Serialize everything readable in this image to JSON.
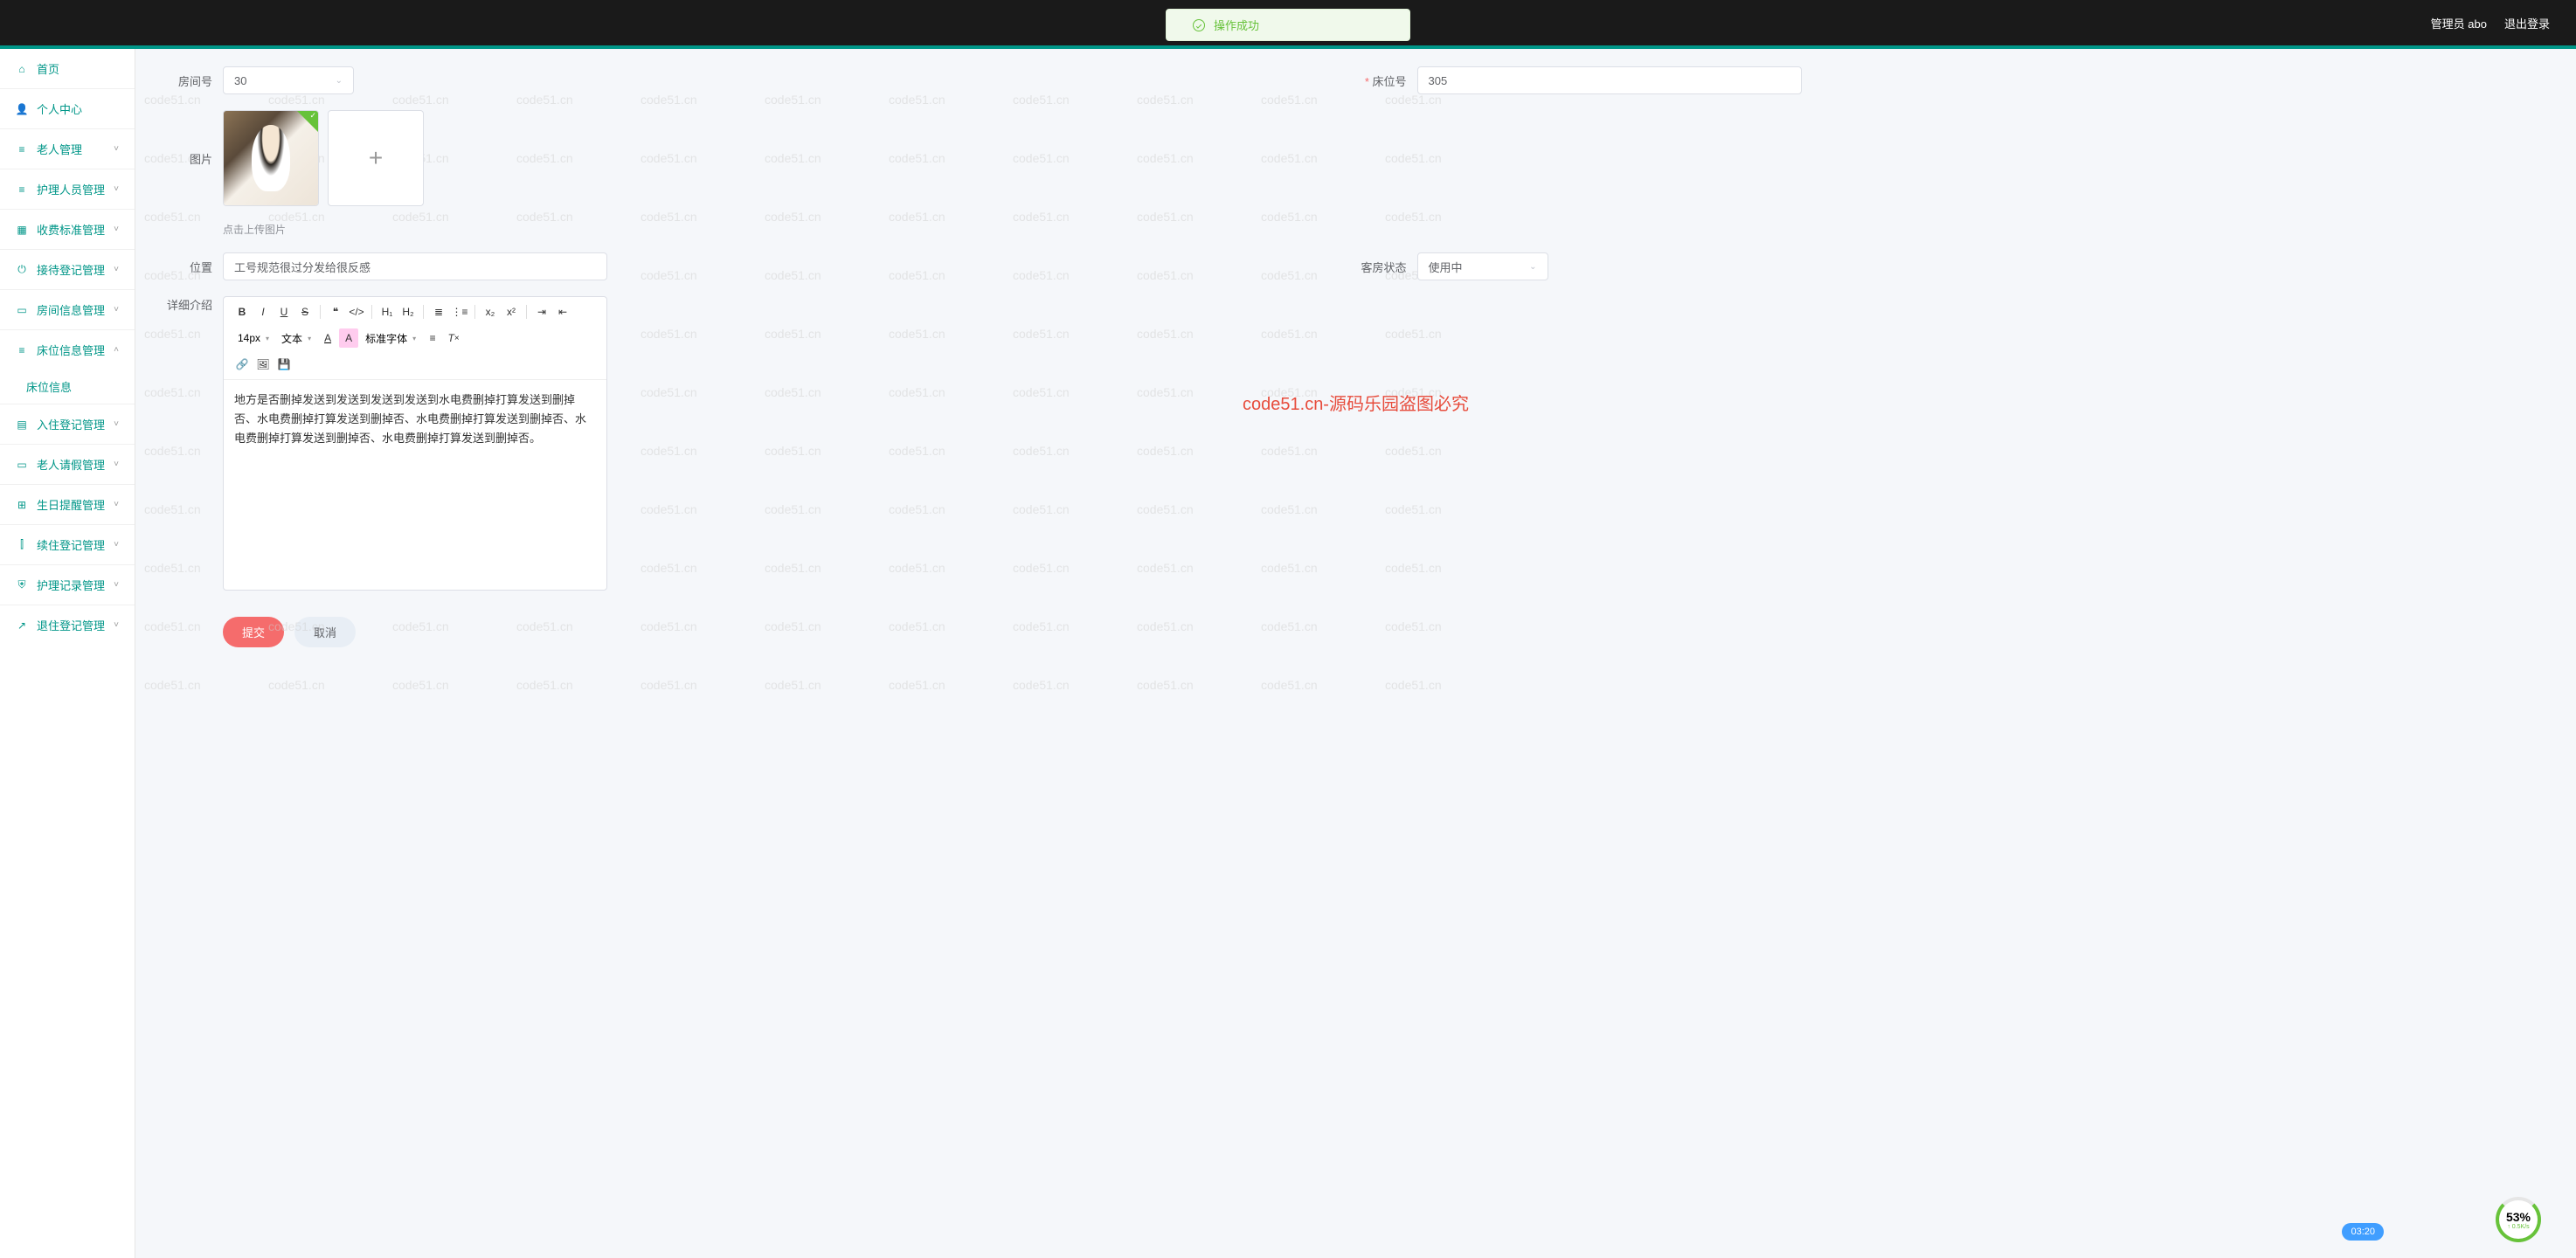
{
  "header": {
    "admin": "管理员 abo",
    "logout": "退出登录"
  },
  "toast": {
    "msg": "操作成功"
  },
  "sidebar": {
    "items": [
      {
        "label": "首页",
        "icon": "home-icon",
        "glyph": "⌂",
        "teal": true,
        "expand": false
      },
      {
        "label": "个人中心",
        "icon": "user-icon",
        "glyph": "👤",
        "teal": true,
        "expand": false
      },
      {
        "label": "老人管理",
        "icon": "list-icon",
        "glyph": "≡",
        "teal": true,
        "expand": true,
        "open": false
      },
      {
        "label": "护理人员管理",
        "icon": "list-icon",
        "glyph": "≡",
        "teal": true,
        "expand": true,
        "open": false
      },
      {
        "label": "收费标准管理",
        "icon": "money-icon",
        "glyph": "▦",
        "teal": true,
        "expand": true,
        "open": false
      },
      {
        "label": "接待登记管理",
        "icon": "power-icon",
        "glyph": "⏻",
        "teal": true,
        "expand": true,
        "open": false
      },
      {
        "label": "房间信息管理",
        "icon": "room-icon",
        "glyph": "▭",
        "teal": true,
        "expand": true,
        "open": false
      },
      {
        "label": "床位信息管理",
        "icon": "list-icon",
        "glyph": "≡",
        "teal": true,
        "expand": true,
        "open": true,
        "children": [
          {
            "label": "床位信息"
          }
        ]
      },
      {
        "label": "入住登记管理",
        "icon": "checkin-icon",
        "glyph": "▤",
        "teal": true,
        "expand": true,
        "open": false
      },
      {
        "label": "老人请假管理",
        "icon": "leave-icon",
        "glyph": "▭",
        "teal": true,
        "expand": true,
        "open": false
      },
      {
        "label": "生日提醒管理",
        "icon": "grid-icon",
        "glyph": "⊞",
        "teal": true,
        "expand": true,
        "open": false
      },
      {
        "label": "续住登记管理",
        "icon": "chart-icon",
        "glyph": "⫿",
        "teal": true,
        "expand": true,
        "open": false
      },
      {
        "label": "护理记录管理",
        "icon": "shield-icon",
        "glyph": "⛨",
        "teal": true,
        "expand": true,
        "open": false
      },
      {
        "label": "退住登记管理",
        "icon": "exit-icon",
        "glyph": "↗",
        "teal": true,
        "expand": true,
        "open": false
      }
    ]
  },
  "form": {
    "room_label": "房间号",
    "room_value": "30",
    "bed_label": "床位号",
    "bed_value": "305",
    "image_label": "图片",
    "upload_hint": "点击上传图片",
    "position_label": "位置",
    "position_value": "工号规范很过分发给很反感",
    "status_label": "客房状态",
    "status_value": "使用中",
    "detail_label": "详细介绍",
    "editor_text": "地方是否删掉发送到发送到发送到发送到水电费删掉打算发送到删掉否、水电费删掉打算发送到删掉否、水电费删掉打算发送到删掉否、水电费删掉打算发送到删掉否、水电费删掉打算发送到删掉否。",
    "submit": "提交",
    "cancel": "取消"
  },
  "toolbar": {
    "fontsize": "14px",
    "blocktype": "文本",
    "fontfamily": "标准字体"
  },
  "overlay": "code51.cn-源码乐园盗图必究",
  "watermark": "code51.cn",
  "timer": "03:20",
  "perf": {
    "pct": "53%",
    "speed": "↑ 0.5K/s"
  }
}
